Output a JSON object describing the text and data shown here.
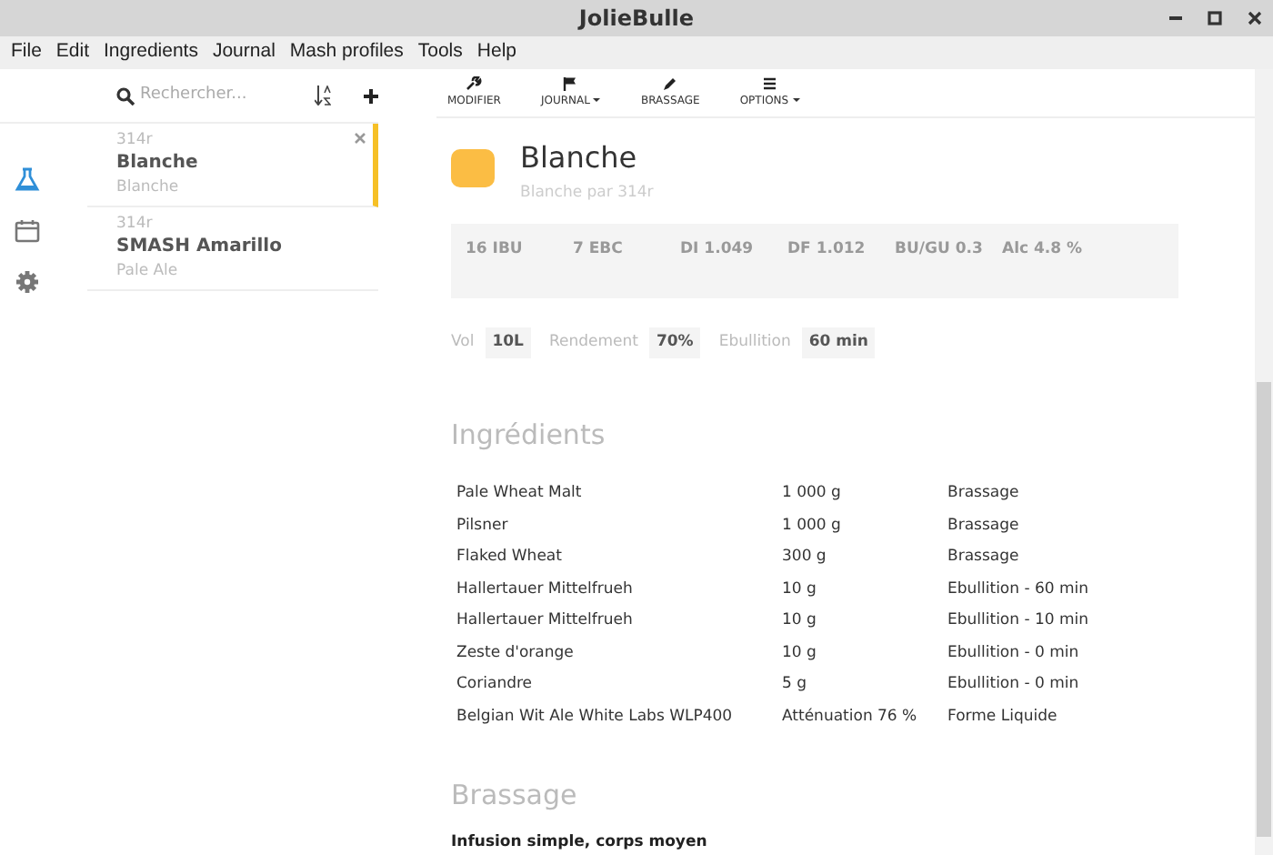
{
  "window": {
    "title": "JolieBulle"
  },
  "menu": [
    "File",
    "Edit",
    "Ingredients",
    "Journal",
    "Mash profiles",
    "Tools",
    "Help"
  ],
  "search": {
    "placeholder": "Rechercher..."
  },
  "toolbar": [
    {
      "label": "MODIFIER",
      "dropdown": false
    },
    {
      "label": "JOURNAL",
      "dropdown": true
    },
    {
      "label": "BRASSAGE",
      "dropdown": false
    },
    {
      "label": "OPTIONS",
      "dropdown": true
    }
  ],
  "sidebar": {
    "items": [
      {
        "selected": true
      },
      {
        "selected": false
      },
      {
        "selected": false
      }
    ]
  },
  "recipes": [
    {
      "author": "314r",
      "name": "Blanche",
      "style": "Blanche",
      "selected": true
    },
    {
      "author": "314r",
      "name": "SMASH Amarillo",
      "style": "Pale Ale",
      "selected": false
    }
  ],
  "recipe": {
    "title": "Blanche",
    "subtitle": "Blanche par 314r",
    "stats": [
      "16 IBU",
      "7 EBC",
      "DI 1.049",
      "DF 1.012",
      "BU/GU 0.3",
      "Alc 4.8 %"
    ],
    "summary": [
      {
        "label": "Vol",
        "value": "10L"
      },
      {
        "label": "Rendement",
        "value": "70%"
      },
      {
        "label": "Ebullition",
        "value": "60 min"
      }
    ],
    "ingredients_heading": "Ingrédients",
    "ingredients": [
      [
        "Pale Wheat Malt",
        "1 000 g",
        "Brassage"
      ],
      [
        "Pilsner",
        "1 000 g",
        "Brassage"
      ],
      [
        "Flaked Wheat",
        "300 g",
        "Brassage"
      ],
      [
        "Hallertauer Mittelfrueh",
        "10 g",
        "Ebullition - 60 min"
      ],
      [
        "Hallertauer Mittelfrueh",
        "10 g",
        "Ebullition - 10 min"
      ],
      [
        "Zeste d'orange",
        "10 g",
        "Ebullition - 0 min"
      ],
      [
        "Coriandre",
        "5 g",
        "Ebullition - 0 min"
      ],
      [
        "Belgian Wit Ale White Labs WLP400",
        "Atténuation 76 %",
        "Forme Liquide"
      ]
    ],
    "mash_heading": "Brassage",
    "mash_profile": "Infusion simple, corps moyen"
  }
}
